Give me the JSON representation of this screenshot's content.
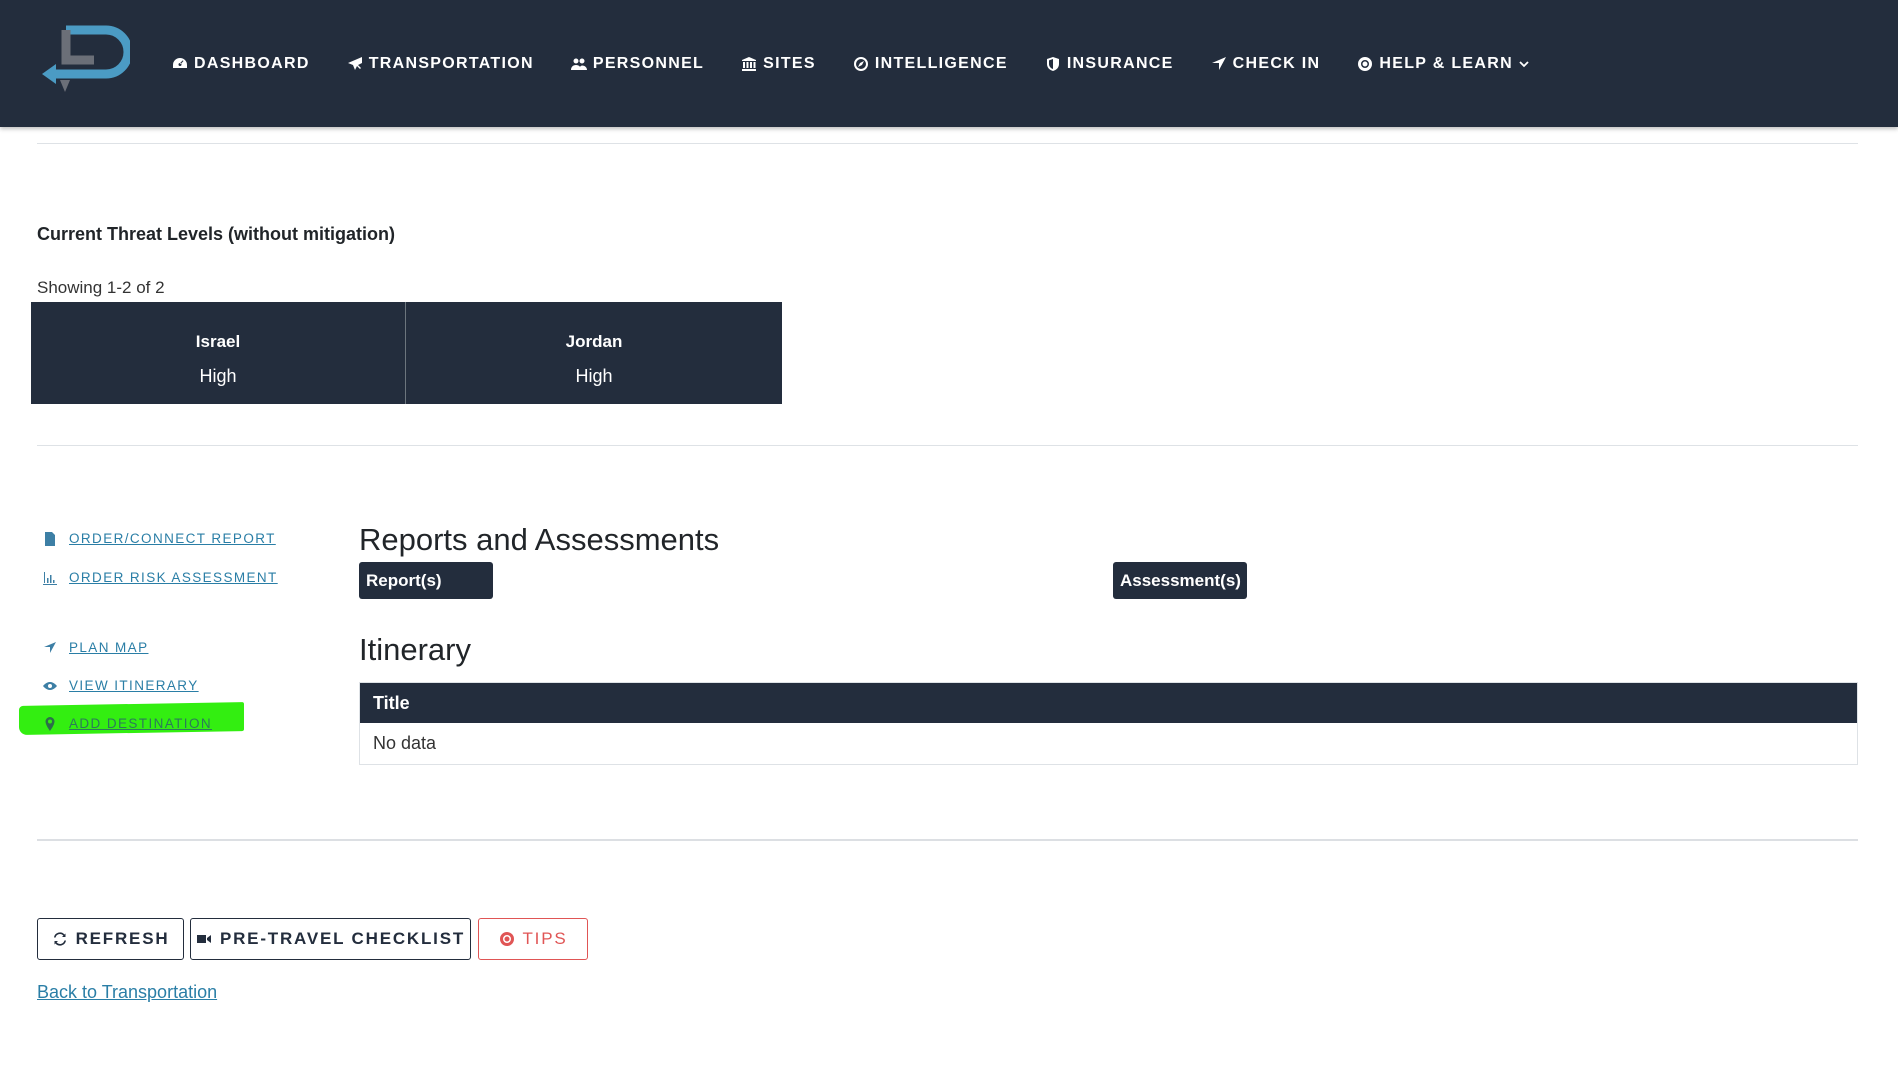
{
  "nav": {
    "items": [
      {
        "label": "DASHBOARD",
        "icon": "dashboard-icon"
      },
      {
        "label": "TRANSPORTATION",
        "icon": "plane-icon"
      },
      {
        "label": "PERSONNEL",
        "icon": "users-icon"
      },
      {
        "label": "SITES",
        "icon": "building-icon"
      },
      {
        "label": "INTELLIGENCE",
        "icon": "compass-icon"
      },
      {
        "label": "INSURANCE",
        "icon": "shield-icon"
      },
      {
        "label": "CHECK IN",
        "icon": "location-arrow-icon"
      },
      {
        "label": "HELP & LEARN",
        "icon": "lifebuoy-icon"
      }
    ]
  },
  "threat": {
    "title": "Current Threat Levels (without mitigation)",
    "showing": "Showing 1-2 of 2",
    "cards": [
      {
        "country": "Israel",
        "level": "High"
      },
      {
        "country": "Jordan",
        "level": "High"
      }
    ]
  },
  "side_links": {
    "order_report": "ORDER/CONNECT REPORT",
    "order_risk": "ORDER RISK ASSESSMENT",
    "plan_map": "PLAN MAP",
    "view_itinerary": "VIEW ITINERARY",
    "add_destination": "ADD DESTINATION"
  },
  "reports": {
    "heading": "Reports and Assessments",
    "reports_tag": "Report(s)",
    "assessments_tag": "Assessment(s)"
  },
  "itinerary": {
    "heading": "Itinerary",
    "column": "Title",
    "empty": "No data"
  },
  "buttons": {
    "refresh": "REFRESH",
    "checklist": "PRE-TRAVEL CHECKLIST",
    "tips": "TIPS"
  },
  "back_link": "Back to Transportation",
  "colors": {
    "navbar": "#232d3d",
    "link": "#2a7ea6",
    "highlight": "#33ee11",
    "tips": "#e05555"
  }
}
